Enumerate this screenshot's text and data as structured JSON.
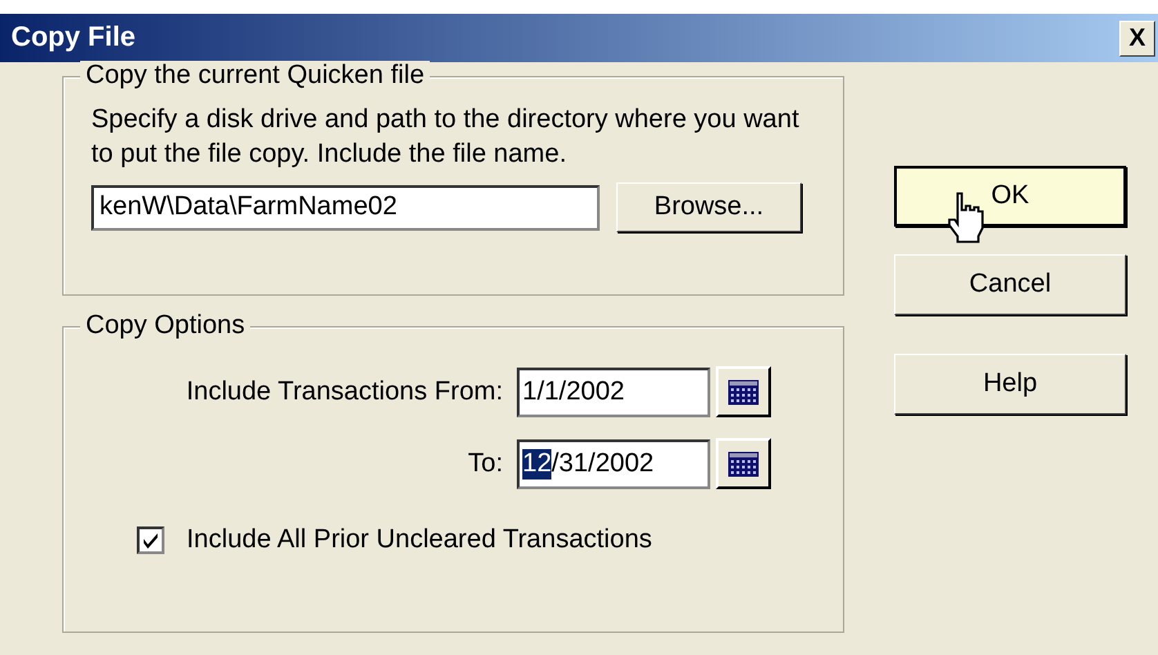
{
  "window": {
    "title": "Copy File",
    "close_label": "X"
  },
  "copy_group": {
    "legend": "Copy the current Quicken file",
    "instructions": "Specify a disk drive and path to the directory where you want to put the file copy. Include the file name.",
    "path_value": "kenW\\Data\\FarmName02",
    "browse_label": "Browse..."
  },
  "options_group": {
    "legend": "Copy Options",
    "dates": [
      {
        "label": "Include Transactions From:",
        "parts": [
          {
            "text": "1/1/2002",
            "selected": false
          }
        ]
      },
      {
        "label": "To:",
        "parts": [
          {
            "text": "12",
            "selected": true
          },
          {
            "text": "/31/2002",
            "selected": false
          }
        ]
      }
    ],
    "checkbox": {
      "label": "Include All Prior Uncleared Transactions",
      "checked": true
    }
  },
  "buttons": [
    {
      "label": "OK",
      "hovered": true
    },
    {
      "label": "Cancel",
      "hovered": false
    },
    {
      "label": "Help",
      "hovered": false
    }
  ]
}
